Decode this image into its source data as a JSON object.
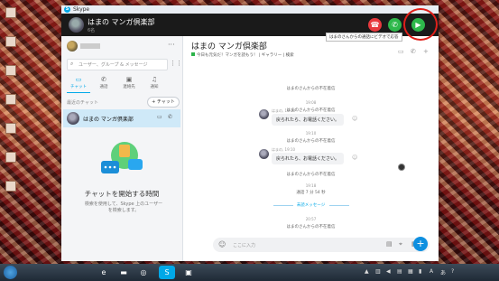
{
  "window": {
    "title": "Skype"
  },
  "header": {
    "contact_name": "はまの マンガ倶楽部",
    "contact_sub": "6名",
    "video_tooltip": "はまのさんからの通話にビデオで応答"
  },
  "sidebar": {
    "search_placeholder": "ユーザー、グループ & メッセージ",
    "tabs": [
      {
        "label": "チャット",
        "icon": "chat-icon"
      },
      {
        "label": "通話",
        "icon": "phone-icon"
      },
      {
        "label": "連絡先",
        "icon": "contacts-icon"
      },
      {
        "label": "通知",
        "icon": "bell-icon"
      }
    ],
    "recent_label": "最近のチャット",
    "new_chat_label": "+ チャット",
    "chat_items": [
      {
        "name": "はまの マンガ倶楽部"
      }
    ],
    "empty_title": "チャットを開始する時間",
    "empty_desc": "検索を使用して、Skype 上のユーザーを検索します。"
  },
  "main": {
    "title": "はまの マンガ倶楽部",
    "subtitle_status": "今日も元気だ！マンガを読もう！",
    "subtitle_gallery": "ギャラリー",
    "subtitle_search": "検索",
    "messages": [
      {
        "kind": "system",
        "text": "はまのさんからの不在着信"
      },
      {
        "kind": "time",
        "text": "19:08"
      },
      {
        "kind": "system",
        "text": "はまのさんからの不在着信"
      },
      {
        "kind": "bubble",
        "author": "はまの",
        "time": "19:10",
        "text": "戻られたら、お電話ください。"
      },
      {
        "kind": "time",
        "text": "19:10"
      },
      {
        "kind": "system",
        "text": "はまのさんからの不在着信"
      },
      {
        "kind": "bubble",
        "author": "はまの",
        "time": "19:10",
        "text": "戻られたら、お電話ください。"
      },
      {
        "kind": "system",
        "text": "はまのさんからの不在着信"
      },
      {
        "kind": "time",
        "text": "19:18"
      },
      {
        "kind": "system",
        "text": "通話 7 分 54 秒"
      },
      {
        "kind": "new",
        "text": "未読メッセージ"
      },
      {
        "kind": "time",
        "text": "20:57"
      },
      {
        "kind": "system",
        "text": "はまのさんからの不在着信"
      }
    ],
    "composer_placeholder": "ここに入力"
  },
  "colors": {
    "accent": "#00a8e8",
    "end_call": "#e8383d",
    "answer": "#2eb84b"
  }
}
